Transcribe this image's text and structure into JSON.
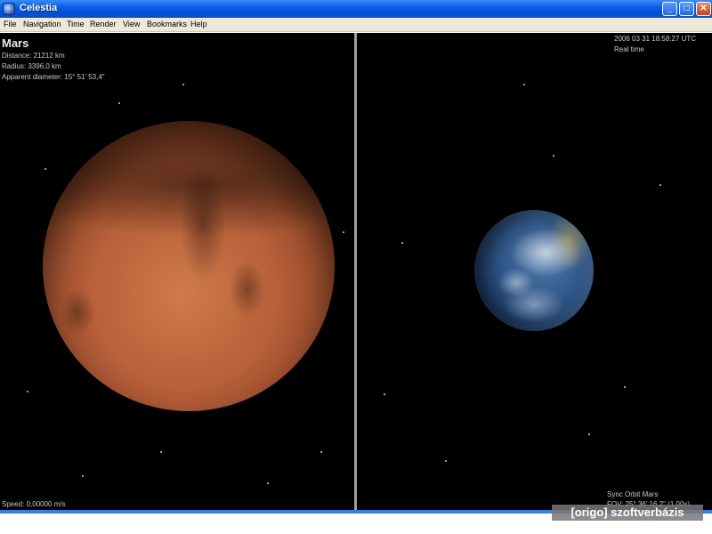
{
  "window": {
    "title": "Celestia",
    "minimize": "_",
    "maximize": "□",
    "close": "✕"
  },
  "menu": [
    "File",
    "Navigation",
    "Time",
    "Render",
    "View",
    "Bookmarks",
    "Help"
  ],
  "left_view": {
    "object_name": "Mars",
    "distance": "Distance: 21212 km",
    "radius": "Radius: 3396,0 km",
    "apparent_diameter": "Apparent diameter: 15° 51' 53,4\"",
    "speed": "Speed: 0,00000 m/s"
  },
  "right_view": {
    "datetime": "2006 03 31 18:58:27 UTC",
    "time_mode": "Real time",
    "sync": "Sync Orbit Mars",
    "fov": "FOV: 25° 36' 16,2\" (1,00x)"
  },
  "watermark": "[origo] szoftverbázis"
}
